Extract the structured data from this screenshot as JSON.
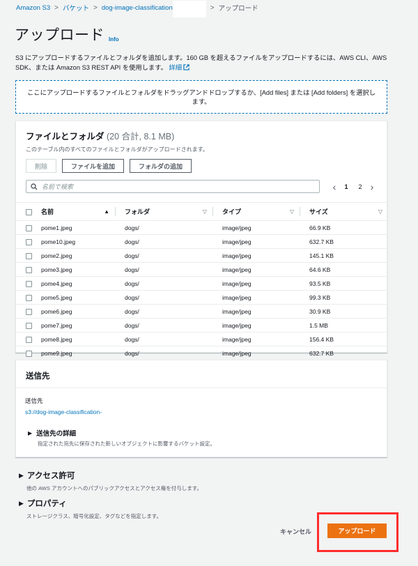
{
  "breadcrumb": {
    "items": [
      "Amazon S3",
      "バケット",
      "dog-image-classification"
    ],
    "current": "アップロード"
  },
  "page": {
    "title": "アップロード",
    "info": "Info",
    "description": "S3 にアップロードするファイルとフォルダを追加します。160 GB を超えるファイルをアップロードするには、AWS CLI、AWS SDK、または Amazon S3 REST API を使用します。",
    "detail_link": "詳細"
  },
  "dropzone": {
    "text": "ここにアップロードするファイルとフォルダをドラッグアンドドロップするか、[Add files] または [Add folders] を選択します。"
  },
  "files": {
    "title": "ファイルとフォルダ",
    "count": "(20 合計, 8.1 MB)",
    "subtitle": "このテーブル内のすべてのファイルとフォルダがアップロードされます。",
    "buttons": {
      "delete": "削除",
      "add_files": "ファイルを追加",
      "add_folder": "フォルダの追加"
    },
    "search_placeholder": "名前で検索",
    "pager": {
      "pages": [
        "1",
        "2"
      ],
      "current": "1"
    },
    "columns": {
      "name": "名前",
      "folder": "フォルダ",
      "type": "タイプ",
      "size": "サイズ"
    },
    "rows": [
      {
        "name": "pome1.jpeg",
        "folder": "dogs/",
        "type": "image/jpeg",
        "size": "66.9 KB"
      },
      {
        "name": "pome10.jpeg",
        "folder": "dogs/",
        "type": "image/jpeg",
        "size": "632.7 KB"
      },
      {
        "name": "pome2.jpeg",
        "folder": "dogs/",
        "type": "image/jpeg",
        "size": "145.1 KB"
      },
      {
        "name": "pome3.jpeg",
        "folder": "dogs/",
        "type": "image/jpeg",
        "size": "64.6 KB"
      },
      {
        "name": "pome4.jpeg",
        "folder": "dogs/",
        "type": "image/jpeg",
        "size": "93.5 KB"
      },
      {
        "name": "pome5.jpeg",
        "folder": "dogs/",
        "type": "image/jpeg",
        "size": "99.3 KB"
      },
      {
        "name": "pome6.jpeg",
        "folder": "dogs/",
        "type": "image/jpeg",
        "size": "30.9 KB"
      },
      {
        "name": "pome7.jpeg",
        "folder": "dogs/",
        "type": "image/jpeg",
        "size": "1.5 MB"
      },
      {
        "name": "pome8.jpeg",
        "folder": "dogs/",
        "type": "image/jpeg",
        "size": "156.4 KB"
      },
      {
        "name": "pome9.jpeg",
        "folder": "dogs/",
        "type": "image/jpeg",
        "size": "632.7 KB"
      }
    ]
  },
  "destination": {
    "title": "送信先",
    "label": "送信先",
    "value": "s3://dog-image-classification-",
    "details_title": "送信先の詳細",
    "details_desc": "指定された宛先に保存された新しいオブジェクトに影響するバケット設定。"
  },
  "permissions": {
    "title": "アクセス許可",
    "desc": "他の AWS アカウントへのパブリックアクセスとアクセス権を付与します。"
  },
  "properties": {
    "title": "プロパティ",
    "desc": "ストレージクラス、暗号化設定、タグなどを指定します。"
  },
  "footer": {
    "cancel": "キャンセル",
    "upload": "アップロード"
  },
  "colors": {
    "link": "#0073bb",
    "primary": "#ec7211",
    "highlight": "#ff2d2d"
  }
}
